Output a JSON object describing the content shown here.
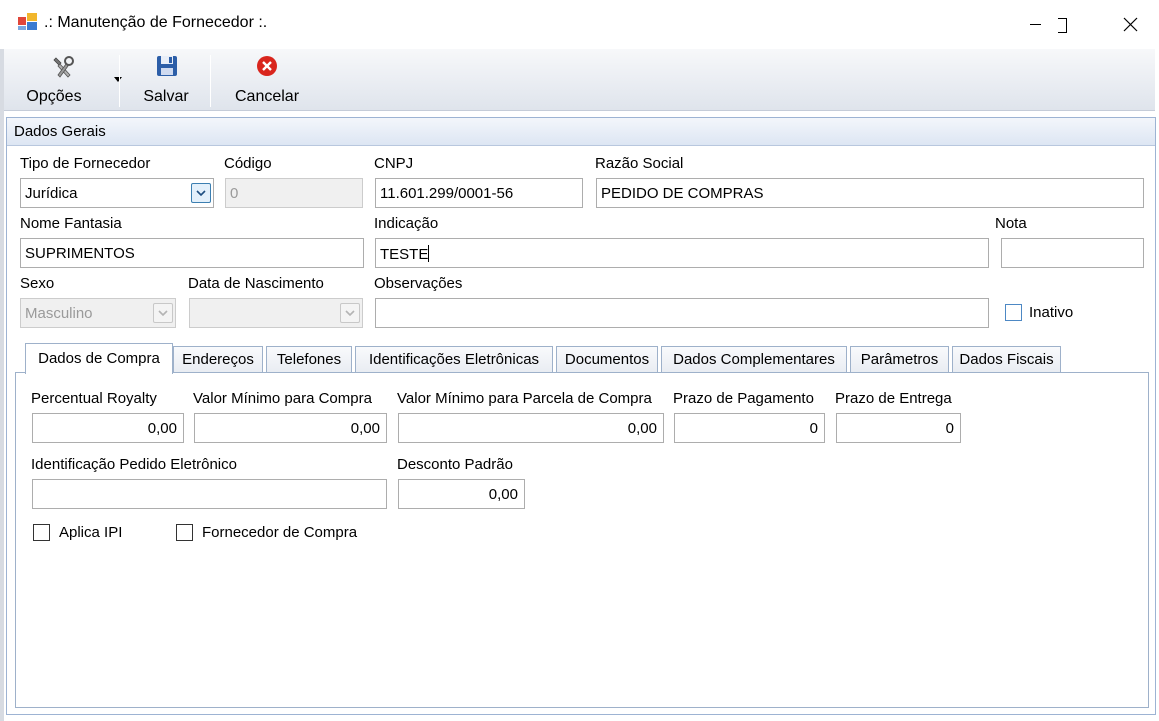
{
  "window": {
    "title": ".: Manutenção de Fornecedor :.",
    "controls": [
      "minimize",
      "maximize",
      "close"
    ]
  },
  "toolbar": {
    "opcoes_label": "Opções",
    "salvar_label": "Salvar",
    "cancelar_label": "Cancelar"
  },
  "dados_gerais": {
    "header": "Dados Gerais",
    "tipo_fornecedor": {
      "label": "Tipo de Fornecedor",
      "value": "Jurídica"
    },
    "codigo": {
      "label": "Código",
      "value": "0"
    },
    "cnpj": {
      "label": "CNPJ",
      "value": "11.601.299/0001-56"
    },
    "razao_social": {
      "label": "Razão Social",
      "value": "PEDIDO DE COMPRAS"
    },
    "nome_fantasia": {
      "label": "Nome Fantasia",
      "value": "SUPRIMENTOS"
    },
    "indicacao": {
      "label": "Indicação",
      "value": "TESTE"
    },
    "nota": {
      "label": "Nota",
      "value": ""
    },
    "sexo": {
      "label": "Sexo",
      "value": "Masculino"
    },
    "data_nascimento": {
      "label": "Data de Nascimento",
      "value": ""
    },
    "observacoes": {
      "label": "Observações",
      "value": ""
    },
    "inativo": {
      "label": "Inativo",
      "checked": false
    }
  },
  "tabs": [
    {
      "label": "Dados de Compra",
      "active": true
    },
    {
      "label": "Endereços"
    },
    {
      "label": "Telefones"
    },
    {
      "label": "Identificações Eletrônicas"
    },
    {
      "label": "Documentos"
    },
    {
      "label": "Dados Complementares"
    },
    {
      "label": "Parâmetros"
    },
    {
      "label": "Dados Fiscais"
    }
  ],
  "dados_compra": {
    "percentual_royalty": {
      "label": "Percentual Royalty",
      "value": "0,00"
    },
    "valor_minimo_compra": {
      "label": "Valor Mínimo para Compra",
      "value": "0,00"
    },
    "valor_minimo_parcela": {
      "label": "Valor Mínimo para Parcela de Compra",
      "value": "0,00"
    },
    "prazo_pagamento": {
      "label": "Prazo de Pagamento",
      "value": "0"
    },
    "prazo_entrega": {
      "label": "Prazo de Entrega",
      "value": "0"
    },
    "identificacao_pedido": {
      "label": "Identificação Pedido Eletrônico",
      "value": ""
    },
    "desconto_padrao": {
      "label": "Desconto Padrão",
      "value": "0,00"
    },
    "aplica_ipi": {
      "label": "Aplica IPI",
      "checked": false
    },
    "fornecedor_compra": {
      "label": "Fornecedor de Compra",
      "checked": false
    }
  },
  "colors": {
    "accent_blue": "#3c7fb1",
    "cancel_red": "#d9251d",
    "save_blue": "#2c5ea8",
    "panel_border": "#9db3d3"
  }
}
